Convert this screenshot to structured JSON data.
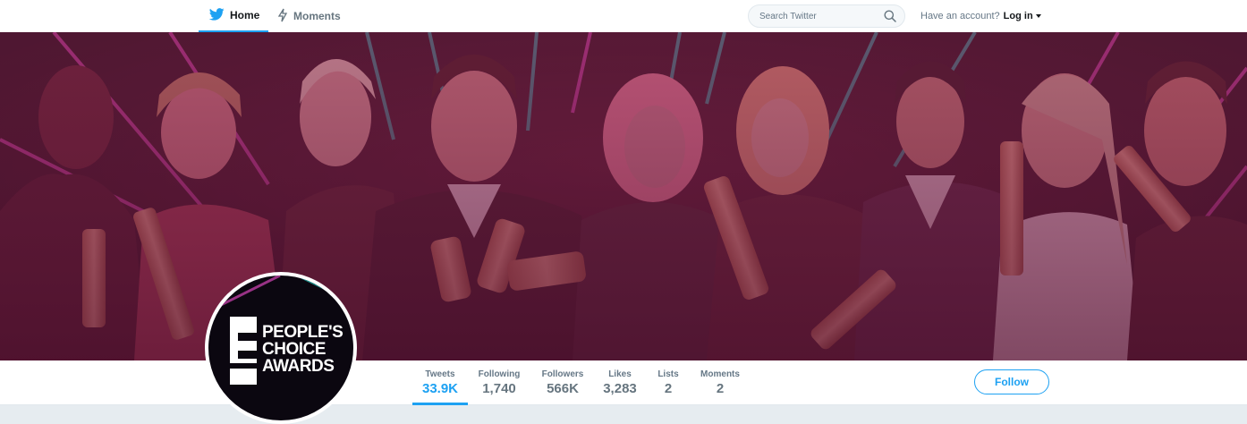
{
  "nav": {
    "home_label": "Home",
    "moments_label": "Moments"
  },
  "search": {
    "placeholder": "Search Twitter"
  },
  "account": {
    "prompt": "Have an account?",
    "login_label": "Log in"
  },
  "avatar": {
    "logo_lines": [
      "PEOPLE'S",
      "CHOICE",
      "AWARDS"
    ]
  },
  "stats": [
    {
      "label": "Tweets",
      "value": "33.9K"
    },
    {
      "label": "Following",
      "value": "1,740"
    },
    {
      "label": "Followers",
      "value": "566K"
    },
    {
      "label": "Likes",
      "value": "3,283"
    },
    {
      "label": "Lists",
      "value": "2"
    },
    {
      "label": "Moments",
      "value": "2"
    }
  ],
  "follow_label": "Follow",
  "colors": {
    "accent": "#1da1f2",
    "banner_tint": "#d64a8a",
    "banner_bg": "#0a0508"
  },
  "icons": {
    "home": "bird-icon",
    "moments": "lightning-icon",
    "search": "search-icon",
    "login": "chevron-down-icon"
  }
}
